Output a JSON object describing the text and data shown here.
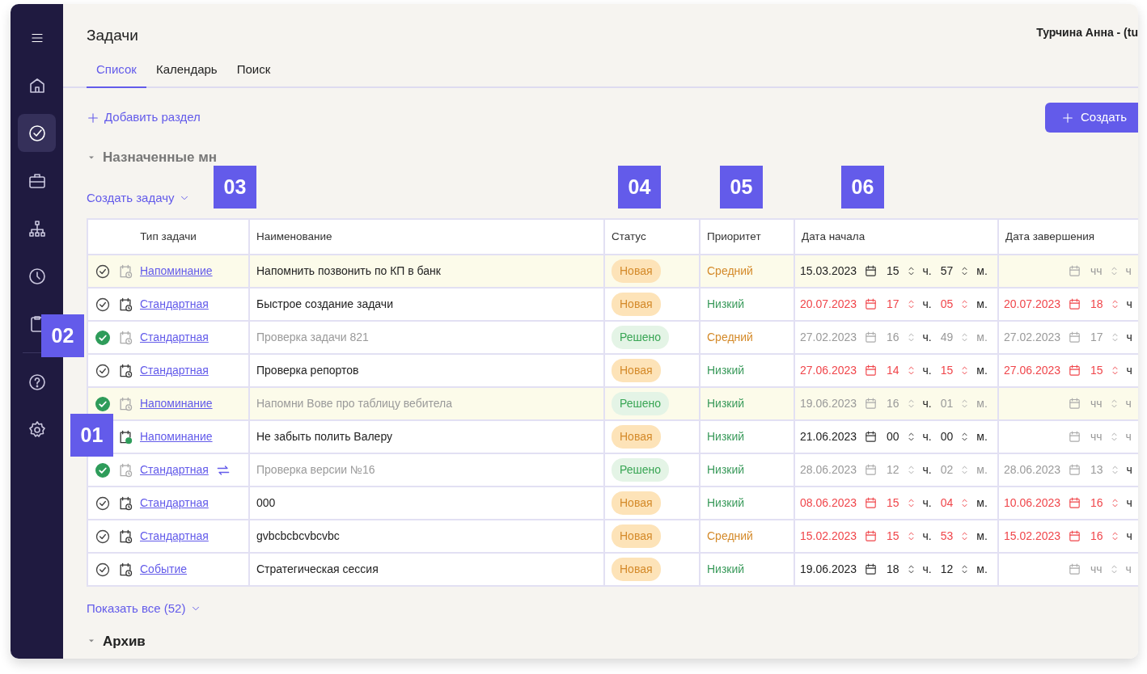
{
  "sidebar": {
    "items": [
      {
        "kind": "home",
        "selected": false
      },
      {
        "kind": "tasks",
        "selected": true
      },
      {
        "kind": "briefcase",
        "selected": false
      },
      {
        "kind": "structure",
        "selected": false
      },
      {
        "kind": "clock",
        "selected": false
      },
      {
        "kind": "clipboard",
        "selected": false
      }
    ],
    "footer_items": [
      {
        "kind": "help",
        "selected": false
      },
      {
        "kind": "settings",
        "selected": false
      }
    ]
  },
  "header": {
    "title": "Задачи",
    "user": "Турчина Анна - (tu"
  },
  "tabs": [
    {
      "label": "Список",
      "selected": true
    },
    {
      "label": "Календарь",
      "selected": false
    },
    {
      "label": "Поиск",
      "selected": false
    }
  ],
  "add_section": "Добавить раздел",
  "create_button": "Создать",
  "section": {
    "title": "Назначенные мн",
    "expanded": true
  },
  "create_task": "Создать задачу",
  "table": {
    "columns": [
      "Тип задачи",
      "Наименование",
      "Статус",
      "Приоритет",
      "Дата начала",
      "Дата завершения"
    ],
    "rows": [
      {
        "done": false,
        "highlighted": true,
        "schedule": {
          "kind": "faded"
        },
        "type": "Напоминание",
        "recurring": false,
        "name": "Напомнить позвонить по КП в банк",
        "status": {
          "label": "Новая",
          "kind": "new"
        },
        "priority": {
          "label": "Средний",
          "kind": "medium"
        },
        "start": {
          "date": "15.03.2023",
          "hour": "15",
          "hour_unit": "ч.",
          "minute": "57",
          "minute_unit": "м.",
          "overdue": false
        },
        "end": {
          "hour_placeholder": "чч",
          "hour_unit": "ч"
        }
      },
      {
        "done": false,
        "highlighted": false,
        "schedule": {
          "kind": "normal"
        },
        "type": "Стандартная",
        "recurring": false,
        "name": "Быстрое создание задачи",
        "status": {
          "label": "Новая",
          "kind": "new"
        },
        "priority": {
          "label": "Низкий",
          "kind": "low"
        },
        "start": {
          "date": "20.07.2023",
          "hour": "17",
          "hour_unit": "ч.",
          "minute": "05",
          "minute_unit": "м.",
          "overdue": true
        },
        "end": {
          "date": "20.07.2023",
          "hour": "18",
          "hour_unit": "ч",
          "overdue": true
        }
      },
      {
        "done": true,
        "highlighted": false,
        "schedule": {
          "kind": "faded"
        },
        "type": "Стандартная",
        "recurring": false,
        "name": "Проверка задачи 821",
        "status": {
          "label": "Решено",
          "kind": "done"
        },
        "priority": {
          "label": "Средний",
          "kind": "medium"
        },
        "start": {
          "date": "27.02.2023",
          "hour": "16",
          "hour_unit": "ч.",
          "minute": "49",
          "minute_unit": "м.",
          "overdue": false
        },
        "end": {
          "date": "27.02.2023",
          "hour": "17",
          "hour_unit": "ч",
          "overdue": false
        }
      },
      {
        "done": false,
        "highlighted": false,
        "schedule": {
          "kind": "normal"
        },
        "type": "Стандартная",
        "recurring": false,
        "name": "Проверка репортов",
        "status": {
          "label": "Новая",
          "kind": "new"
        },
        "priority": {
          "label": "Низкий",
          "kind": "low"
        },
        "start": {
          "date": "27.06.2023",
          "hour": "14",
          "hour_unit": "ч.",
          "minute": "15",
          "minute_unit": "м.",
          "overdue": true
        },
        "end": {
          "date": "27.06.2023",
          "hour": "15",
          "hour_unit": "ч",
          "overdue": true
        }
      },
      {
        "done": true,
        "highlighted": true,
        "schedule": {
          "kind": "faded"
        },
        "type": "Напоминание",
        "recurring": false,
        "name": "Напомни Вове про таблицу вебитела",
        "status": {
          "label": "Решено",
          "kind": "done"
        },
        "priority": {
          "label": "Низкий",
          "kind": "low"
        },
        "start": {
          "date": "19.06.2023",
          "hour": "16",
          "hour_unit": "ч.",
          "minute": "01",
          "minute_unit": "м.",
          "overdue": false
        },
        "end": {
          "hour_placeholder": "чч",
          "hour_unit": "ч"
        }
      },
      {
        "highlighted": false,
        "schedule": {
          "kind": "active"
        },
        "type": "Напоминание",
        "recurring": false,
        "name": "Не забыть полить Валеру",
        "status": {
          "label": "Новая",
          "kind": "new"
        },
        "priority": {
          "label": "Низкий",
          "kind": "low"
        },
        "start": {
          "date": "21.06.2023",
          "hour": "00",
          "hour_unit": "ч.",
          "minute": "00",
          "minute_unit": "м.",
          "overdue": false
        },
        "end": {
          "hour_placeholder": "чч",
          "hour_unit": "ч"
        }
      },
      {
        "done": true,
        "highlighted": false,
        "schedule": {
          "kind": "faded"
        },
        "type": "Стандартная",
        "recurring": true,
        "name": "Проверка версии №16",
        "status": {
          "label": "Решено",
          "kind": "done"
        },
        "priority": {
          "label": "Низкий",
          "kind": "low"
        },
        "start": {
          "date": "28.06.2023",
          "hour": "12",
          "hour_unit": "ч.",
          "minute": "02",
          "minute_unit": "м.",
          "overdue": false
        },
        "end": {
          "date": "28.06.2023",
          "hour": "13",
          "hour_unit": "ч",
          "overdue": false
        }
      },
      {
        "done": false,
        "highlighted": false,
        "schedule": {
          "kind": "normal"
        },
        "type": "Стандартная",
        "recurring": false,
        "name": "000",
        "status": {
          "label": "Новая",
          "kind": "new"
        },
        "priority": {
          "label": "Низкий",
          "kind": "low"
        },
        "start": {
          "date": "08.06.2023",
          "hour": "15",
          "hour_unit": "ч.",
          "minute": "04",
          "minute_unit": "м.",
          "overdue": true
        },
        "end": {
          "date": "10.06.2023",
          "hour": "16",
          "hour_unit": "ч",
          "overdue": true
        }
      },
      {
        "done": false,
        "highlighted": false,
        "schedule": {
          "kind": "normal"
        },
        "type": "Стандартная",
        "recurring": false,
        "name": "gvbcbcbcvbcvbc",
        "status": {
          "label": "Новая",
          "kind": "new"
        },
        "priority": {
          "label": "Средний",
          "kind": "medium"
        },
        "start": {
          "date": "15.02.2023",
          "hour": "15",
          "hour_unit": "ч.",
          "minute": "53",
          "minute_unit": "м.",
          "overdue": true
        },
        "end": {
          "date": "15.02.2023",
          "hour": "16",
          "hour_unit": "ч",
          "overdue": true
        }
      },
      {
        "done": false,
        "highlighted": false,
        "schedule": {
          "kind": "normal"
        },
        "type": "Событие",
        "recurring": false,
        "name": "Стратегическая сессия",
        "status": {
          "label": "Новая",
          "kind": "new"
        },
        "priority": {
          "label": "Низкий",
          "kind": "low"
        },
        "start": {
          "date": "19.06.2023",
          "hour": "18",
          "hour_unit": "ч.",
          "minute": "12",
          "minute_unit": "м.",
          "overdue": false
        },
        "end": {
          "hour_placeholder": "чч",
          "hour_unit": "ч"
        }
      }
    ]
  },
  "show_all": "Показать все (52)",
  "archive": {
    "title": "Архив",
    "expanded": true
  },
  "callouts": [
    {
      "label": "03"
    },
    {
      "label": "04"
    },
    {
      "label": "05"
    },
    {
      "label": "06"
    },
    {
      "label": "02"
    },
    {
      "label": "01"
    }
  ]
}
